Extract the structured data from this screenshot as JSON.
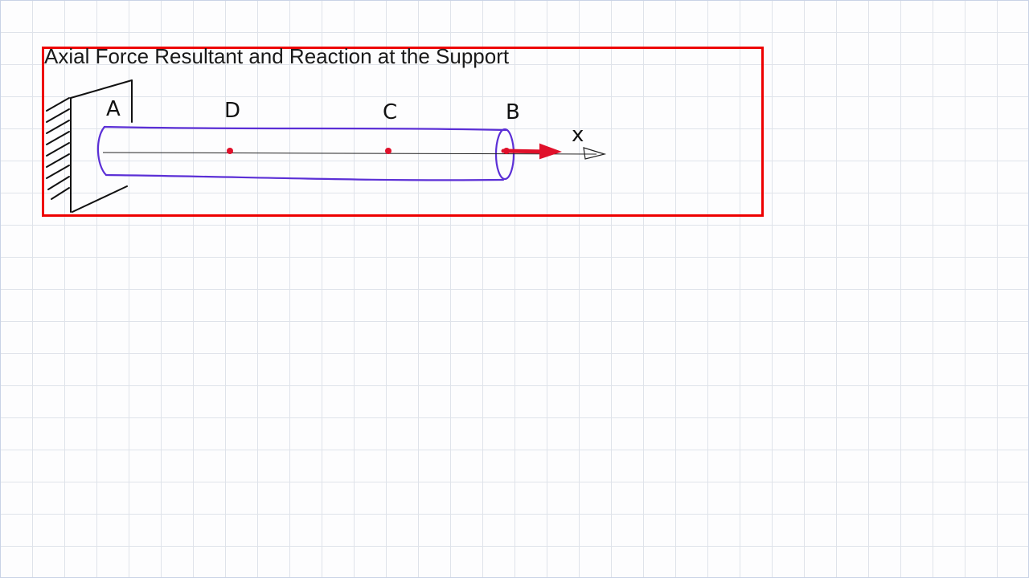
{
  "title": "Axial Force Resultant and Reaction at the Support",
  "labels": {
    "A": "A",
    "D": "D",
    "C": "C",
    "B": "B",
    "x": "x"
  },
  "colors": {
    "highlight": "#ee0000",
    "rod": "#5b2fd6",
    "point": "#e0102a",
    "ink": "#111111"
  },
  "icons": {
    "support": "fixed-wall-support-icon",
    "force": "force-arrow-icon",
    "axis": "x-axis-arrow-icon"
  }
}
